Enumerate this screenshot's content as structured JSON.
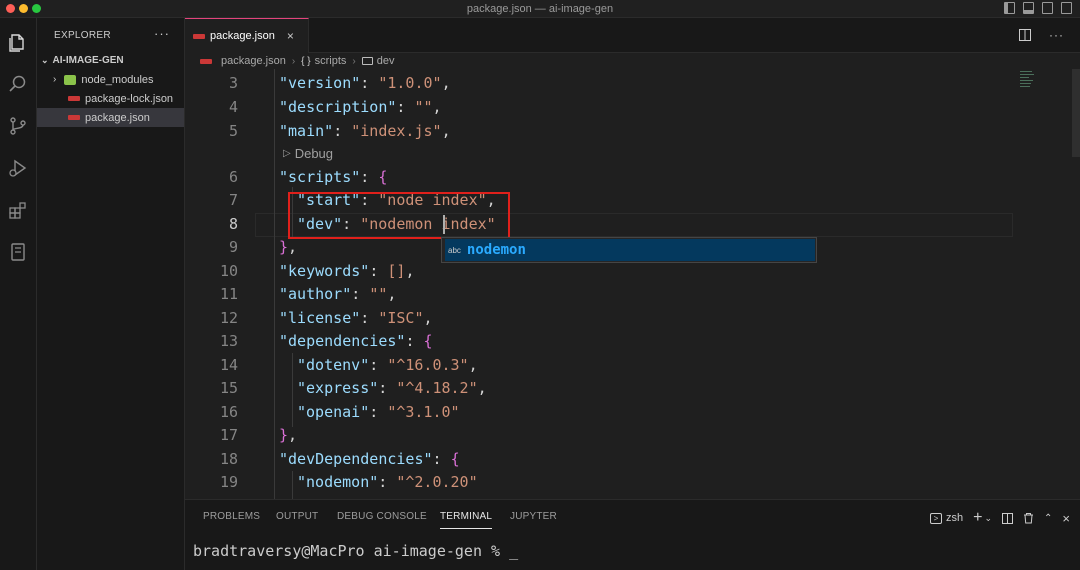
{
  "window": {
    "title": "package.json — ai-image-gen"
  },
  "colors": {
    "close": "#fe5f57",
    "minimize": "#febc2e",
    "maximize": "#28c840",
    "accent": "#e3447c"
  },
  "sidebar": {
    "title": "EXPLORER",
    "more": "···",
    "folder": "AI-IMAGE-GEN",
    "items": [
      {
        "label": "node_modules"
      },
      {
        "label": "package-lock.json"
      },
      {
        "label": "package.json"
      }
    ]
  },
  "tab": {
    "label": "package.json",
    "close": "×"
  },
  "breadcrumb": {
    "file": "package.json",
    "section": "scripts",
    "key": "dev",
    "section_icon": "{ }"
  },
  "editor": {
    "line_numbers": [
      "3",
      "4",
      "5",
      "6",
      "7",
      "8",
      "9",
      "10",
      "11",
      "12",
      "13",
      "14",
      "15",
      "16",
      "17",
      "18",
      "19"
    ],
    "codelens": "Debug",
    "lines": [
      {
        "k": "\"version\"",
        "v": "\"1.0.0\"",
        "t": ","
      },
      {
        "k": "\"description\"",
        "v": "\"\"",
        "t": ","
      },
      {
        "k": "\"main\"",
        "v": "\"index.js\"",
        "t": ","
      },
      {
        "k": "\"scripts\"",
        "o": "{"
      },
      {
        "k": "\"start\"",
        "v": "\"node index\"",
        "t": ","
      },
      {
        "k": "\"dev\"",
        "v": "\"nodemon index\""
      },
      {
        "c": "}",
        "t": ","
      },
      {
        "k": "\"keywords\"",
        "v": "[]",
        "t": ","
      },
      {
        "k": "\"author\"",
        "v": "\"\"",
        "t": ","
      },
      {
        "k": "\"license\"",
        "v": "\"ISC\"",
        "t": ","
      },
      {
        "k": "\"dependencies\"",
        "o": "{"
      },
      {
        "k": "\"dotenv\"",
        "v": "\"^16.0.3\"",
        "t": ","
      },
      {
        "k": "\"express\"",
        "v": "\"^4.18.2\"",
        "t": ","
      },
      {
        "k": "\"openai\"",
        "v": "\"^3.1.0\""
      },
      {
        "c": "}",
        "t": ","
      },
      {
        "k": "\"devDependencies\"",
        "o": "{"
      },
      {
        "k": "\"nodemon\"",
        "v": "\"^2.0.20\""
      }
    ]
  },
  "suggest": {
    "kind": "abc",
    "label": "nodemon"
  },
  "panel": {
    "tabs": [
      "PROBLEMS",
      "OUTPUT",
      "DEBUG CONSOLE",
      "TERMINAL",
      "JUPYTER"
    ],
    "active_tab": "TERMINAL",
    "shell": "zsh",
    "prompt": "bradtraversy@MacPro ai-image-gen % _"
  }
}
